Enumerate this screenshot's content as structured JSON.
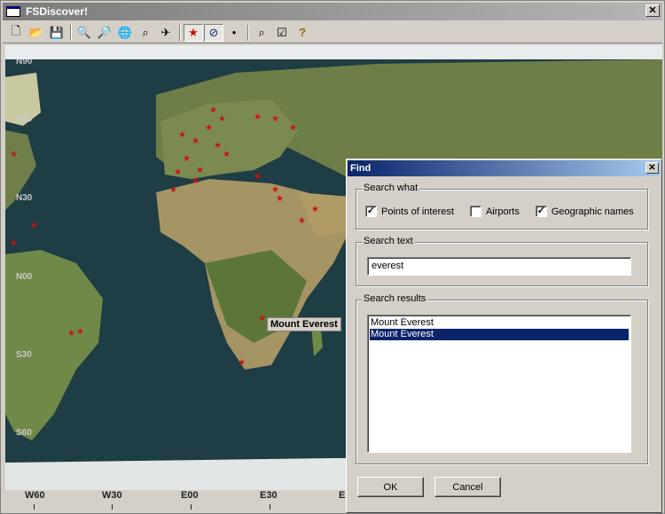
{
  "app": {
    "title": "FSDiscover!"
  },
  "toolbar": {
    "buttons": [
      {
        "name": "new-icon",
        "glyph": "🗋"
      },
      {
        "name": "open-icon",
        "glyph": "📂"
      },
      {
        "name": "save-icon",
        "glyph": "💾"
      },
      {
        "name": "zoom-in-icon",
        "glyph": "🔍"
      },
      {
        "name": "zoom-out-icon",
        "glyph": "🔎"
      },
      {
        "name": "globe-icon",
        "glyph": "🌐"
      },
      {
        "name": "zoom-fit-icon",
        "glyph": "⌕"
      },
      {
        "name": "airplane-icon",
        "glyph": "✈"
      },
      {
        "name": "star-icon",
        "glyph": "★"
      },
      {
        "name": "compass-icon",
        "glyph": "⊘"
      },
      {
        "name": "dot-icon",
        "glyph": "•"
      },
      {
        "name": "find-icon",
        "glyph": "⌕"
      },
      {
        "name": "checkbox-icon",
        "glyph": "☑"
      },
      {
        "name": "help-icon",
        "glyph": "?"
      }
    ]
  },
  "map": {
    "latitude_labels": [
      "N90",
      "N60",
      "N30",
      "N00",
      "S30",
      "S60"
    ],
    "longitude_labels": [
      "W60",
      "W30",
      "E00",
      "E30",
      "E"
    ],
    "tooltip": "Mount Everest",
    "colors": {
      "ocean": "#1e3d44",
      "land": "#8a8a5a",
      "poi": "#cc1111"
    }
  },
  "find_dialog": {
    "title": "Find",
    "search_what": {
      "label": "Search what",
      "options": [
        {
          "label": "Points of interest",
          "checked": true
        },
        {
          "label": "Airports",
          "checked": false
        },
        {
          "label": "Geographic names",
          "checked": true
        }
      ]
    },
    "search_text": {
      "label": "Search text",
      "value": "everest"
    },
    "search_results": {
      "label": "Search results",
      "items": [
        {
          "label": "Mount Everest",
          "selected": false
        },
        {
          "label": "Mount Everest",
          "selected": true
        }
      ]
    },
    "ok_label": "OK",
    "cancel_label": "Cancel"
  }
}
